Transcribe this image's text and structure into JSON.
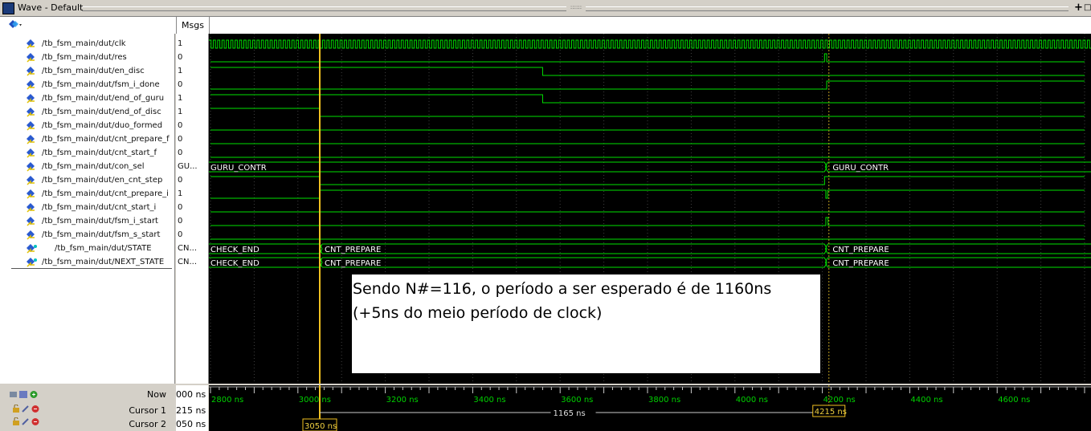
{
  "window": {
    "title": "Wave - Default",
    "grip": "::::::",
    "controls": [
      "+",
      "□"
    ]
  },
  "header": {
    "tool_icon": "diamond-layers-icon",
    "msgs_label": "Msgs"
  },
  "signals": [
    {
      "name": "/tb_fsm_main/dut/clk",
      "value": "1",
      "kind": "bit"
    },
    {
      "name": "/tb_fsm_main/dut/res",
      "value": "0",
      "kind": "bit"
    },
    {
      "name": "/tb_fsm_main/dut/en_disc",
      "value": "1",
      "kind": "bit"
    },
    {
      "name": "/tb_fsm_main/dut/fsm_i_done",
      "value": "0",
      "kind": "bit"
    },
    {
      "name": "/tb_fsm_main/dut/end_of_guru",
      "value": "1",
      "kind": "bit"
    },
    {
      "name": "/tb_fsm_main/dut/end_of_disc",
      "value": "1",
      "kind": "bit"
    },
    {
      "name": "/tb_fsm_main/dut/duo_formed",
      "value": "0",
      "kind": "bit"
    },
    {
      "name": "/tb_fsm_main/dut/cnt_prepare_f",
      "value": "0",
      "kind": "bit"
    },
    {
      "name": "/tb_fsm_main/dut/cnt_start_f",
      "value": "0",
      "kind": "bit"
    },
    {
      "name": "/tb_fsm_main/dut/con_sel",
      "value": "GU...",
      "kind": "bus"
    },
    {
      "name": "/tb_fsm_main/dut/en_cnt_step",
      "value": "0",
      "kind": "bit"
    },
    {
      "name": "/tb_fsm_main/dut/cnt_prepare_i",
      "value": "1",
      "kind": "bit"
    },
    {
      "name": "/tb_fsm_main/dut/cnt_start_i",
      "value": "0",
      "kind": "bit"
    },
    {
      "name": "/tb_fsm_main/dut/fsm_i_start",
      "value": "0",
      "kind": "bit"
    },
    {
      "name": "/tb_fsm_main/dut/fsm_s_start",
      "value": "0",
      "kind": "bit"
    },
    {
      "name": "/tb_fsm_main/dut/STATE",
      "value": "CN...",
      "kind": "state"
    },
    {
      "name": "/tb_fsm_main/dut/NEXT_STATE",
      "value": "CN...",
      "kind": "state"
    }
  ],
  "wave_labels": {
    "con_sel_a": "GURU_CONTR",
    "con_sel_b": "GURU_CONTR",
    "state_a": "CHECK_END",
    "state_b": "CNT_PREPARE",
    "state_c": "CNT_PREPARE",
    "next_a": "CHECK_END",
    "next_b": "CNT_PREPARE",
    "next_c": "CNT_PREPARE"
  },
  "note": "Sendo N#=116, o período a ser esperado é de 1160ns (+5ns do meio período de clock)",
  "bottom": {
    "now_label": "Now",
    "now_value": "000 ns",
    "cursor1_label": "Cursor 1",
    "cursor1_value": "215 ns",
    "cursor2_label": "Cursor 2",
    "cursor2_value": "050 ns"
  },
  "timeline": {
    "ticks": [
      "2800 ns",
      "3000 ns",
      "3200 ns",
      "3400 ns",
      "3600 ns",
      "3800 ns",
      "4000 ns",
      "4200 ns",
      "4400 ns",
      "4600 ns"
    ],
    "delta_label": "1165 ns",
    "cursor1_time": "4215 ns",
    "cursor2_time": "3050 ns"
  },
  "colors": {
    "wave": "#00e000",
    "cursor_active": "#f0c020",
    "cursor_inactive": "#c0a020",
    "grid": "#404040"
  }
}
